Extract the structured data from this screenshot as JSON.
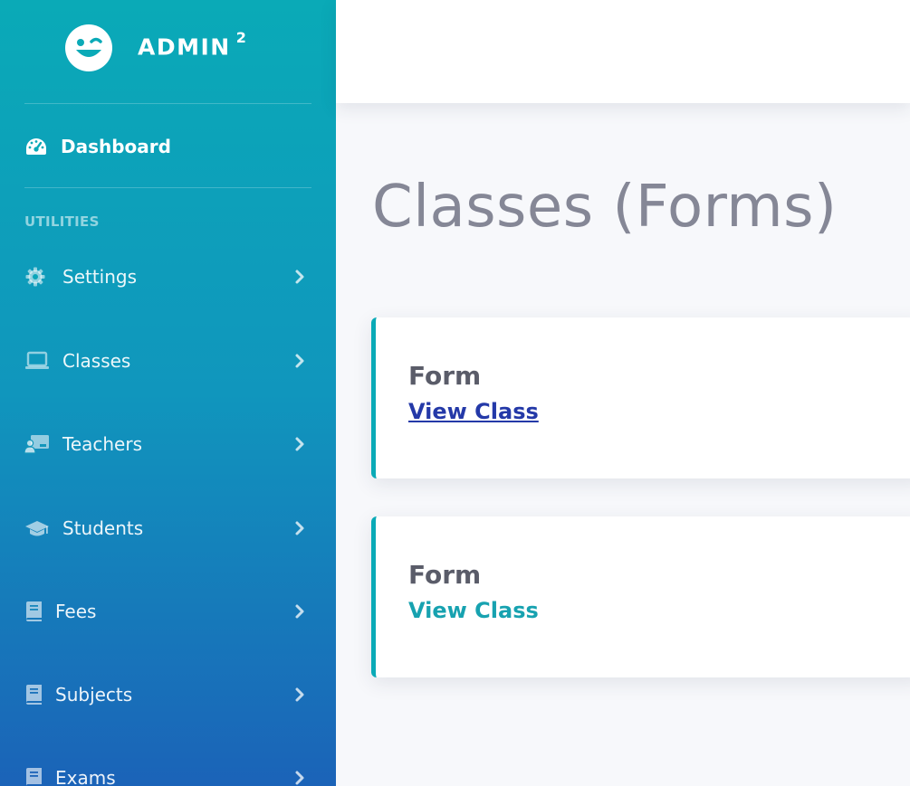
{
  "brand": {
    "name": "ADMIN",
    "superscript": "2",
    "logo_icon": "winking-smiley-icon"
  },
  "sidebar": {
    "dashboard": {
      "label": "Dashboard",
      "icon": "tachometer-icon"
    },
    "heading": "UTILITIES",
    "items": [
      {
        "label": "Settings",
        "icon": "gear-icon"
      },
      {
        "label": "Classes",
        "icon": "laptop-icon"
      },
      {
        "label": "Teachers",
        "icon": "chalkboard-teacher-icon"
      },
      {
        "label": "Students",
        "icon": "graduation-cap-icon"
      },
      {
        "label": "Fees",
        "icon": "book-icon"
      },
      {
        "label": "Subjects",
        "icon": "book-icon"
      },
      {
        "label": "Exams",
        "icon": "book-icon"
      }
    ]
  },
  "main": {
    "title": "Classes (Forms)",
    "cards": [
      {
        "label": "Form",
        "link": "View Class"
      },
      {
        "label": "Form",
        "link": "View Class"
      }
    ]
  },
  "colors": {
    "sidebar_top": "#0aaab7",
    "sidebar_bottom": "#1b63b8",
    "card_accent": "#0aaab7",
    "visited_link": "#2439a8",
    "link": "#17a2b0",
    "title": "#858796"
  }
}
